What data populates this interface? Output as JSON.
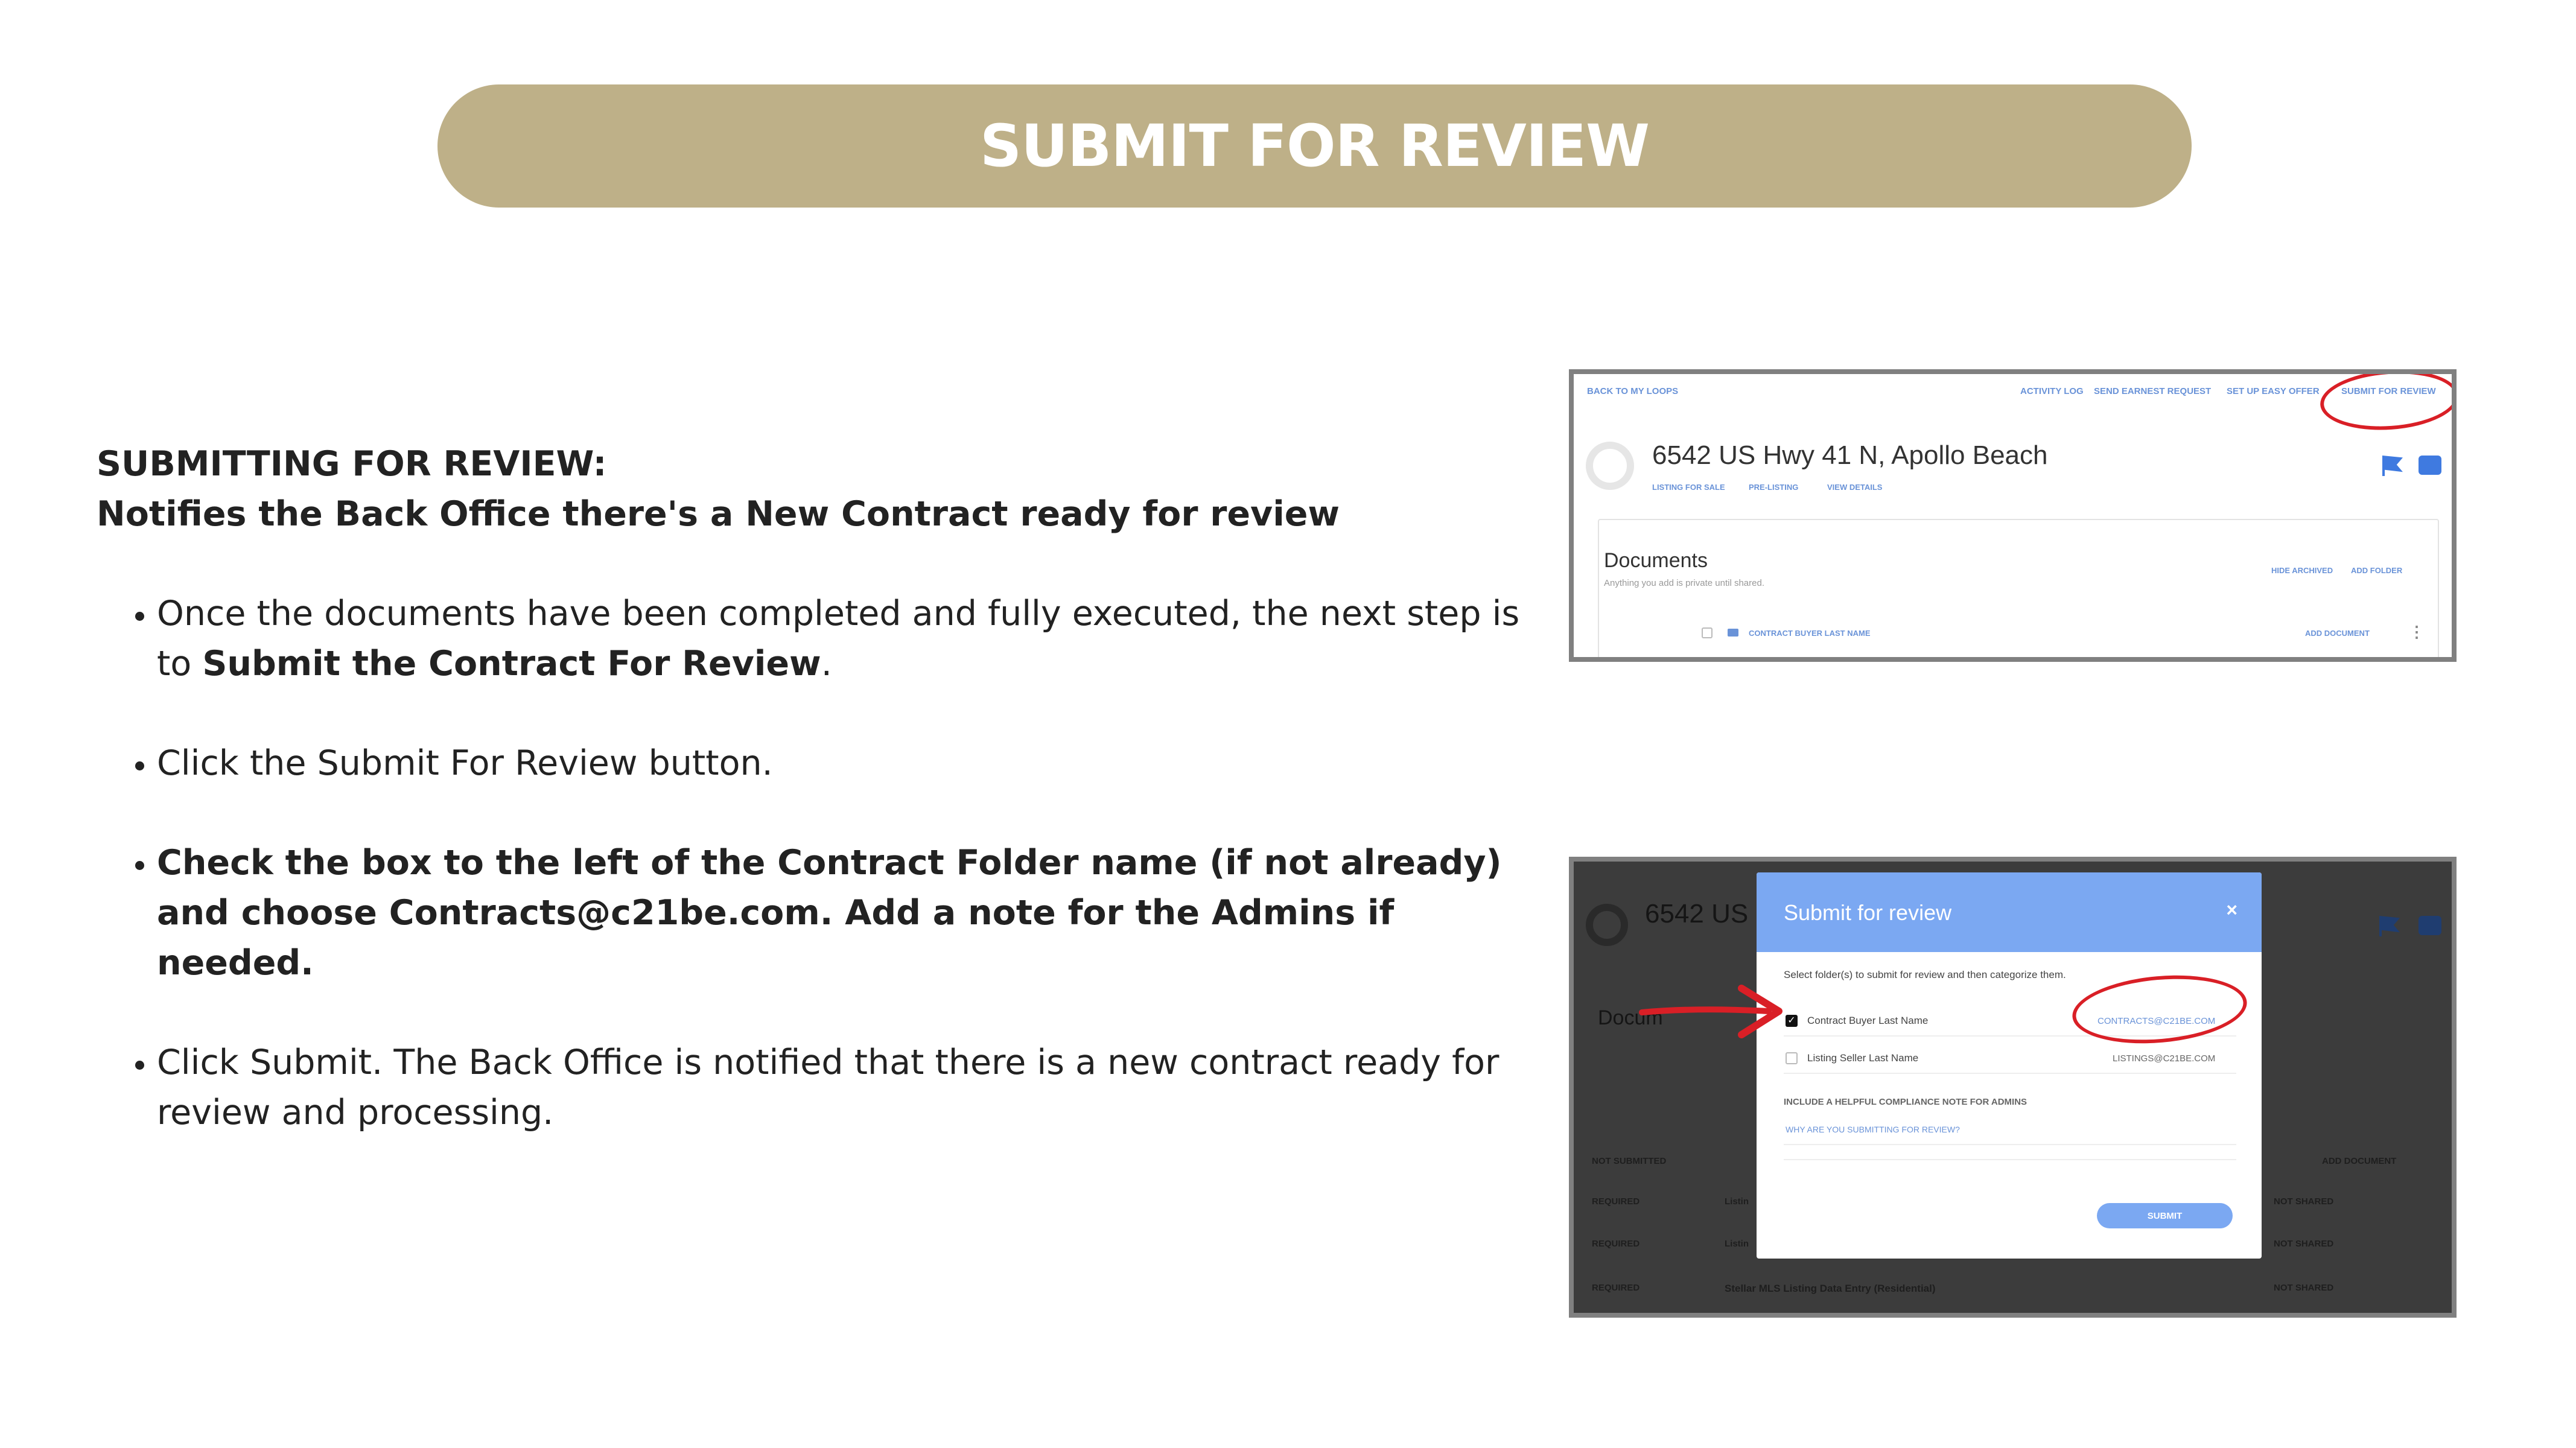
{
  "banner": {
    "title": "SUBMIT FOR REVIEW"
  },
  "colors": {
    "banner_bg": "#beb088",
    "link_blue": "#6a93d8",
    "modal_blue": "#7ba8f2",
    "annotation_red": "#d91f26"
  },
  "intro": {
    "heading_line1": "SUBMITTING FOR REVIEW:",
    "heading_line2": "Notifies the Back Office there's a New Contract ready for review"
  },
  "steps": [
    {
      "text": "Once the documents have been completed and fully executed, the next step is to ",
      "bold": "Submit the Contract For Review",
      "tail": "."
    },
    {
      "text": "Click the Submit For Review button."
    },
    {
      "bold": "Check the box to the left of the Contract Folder name (if not already) and choose Contracts@c21be.com. Add a note for the Admins if needed."
    },
    {
      "text": "Click Submit. The Back Office is notified that there is a new contract ready for review and processing."
    }
  ],
  "screenshot1": {
    "back_link": "BACK TO MY LOOPS",
    "nav": [
      "ACTIVITY LOG",
      "SEND EARNEST REQUEST",
      "SET UP EASY OFFER",
      "SUBMIT FOR REVIEW"
    ],
    "address": "6542 US Hwy 41 N, Apollo Beach",
    "sub_links": [
      "LISTING FOR SALE",
      "PRE-LISTING",
      "VIEW DETAILS"
    ],
    "docs_title": "Documents",
    "docs_subtitle": "Anything you add is private until shared.",
    "docs_actions": [
      "HIDE ARCHIVED",
      "ADD FOLDER"
    ],
    "folder_name": "CONTRACT BUYER LAST NAME",
    "add_document": "ADD DOCUMENT",
    "icons": [
      "flag-icon",
      "chat-icon",
      "folder-icon",
      "more-icon"
    ]
  },
  "screenshot2": {
    "bg_address": "6542 US H",
    "bg_docs": "Docum",
    "bg_rows": [
      {
        "status": "NOT SUBMITTED",
        "name": "",
        "share": "ADD DOCUMENT"
      },
      {
        "status": "REQUIRED",
        "name": "Listin",
        "share": "NOT SHARED"
      },
      {
        "status": "REQUIRED",
        "name": "Listin",
        "share": "NOT SHARED"
      },
      {
        "status": "REQUIRED",
        "name": "Stellar MLS Listing Data Entry (Residential)",
        "share": "NOT SHARED"
      }
    ],
    "modal": {
      "title": "Submit for review",
      "close": "×",
      "instruction": "Select folder(s) to submit for review and then categorize them.",
      "folders": [
        {
          "name": "Contract Buyer Last Name",
          "checked": true,
          "email": "CONTRACTS@C21BE.COM"
        },
        {
          "name": "Listing Seller Last Name",
          "checked": false,
          "email": "LISTINGS@C21BE.COM"
        }
      ],
      "note_label": "INCLUDE A HELPFUL COMPLIANCE NOTE FOR ADMINS",
      "note_placeholder": "WHY ARE YOU SUBMITTING FOR REVIEW?",
      "submit_label": "SUBMIT"
    }
  }
}
